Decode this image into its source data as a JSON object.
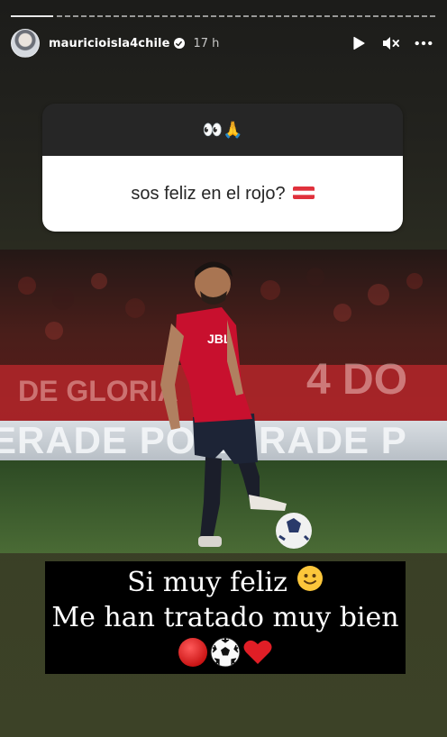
{
  "story": {
    "progress_fraction": 0.1,
    "header": {
      "username": "mauricioisla4chile",
      "verified": true,
      "time": "17 h",
      "controls": [
        "play-icon",
        "mute-icon",
        "more-icon"
      ]
    },
    "question_sticker": {
      "emojis": "👀🙏",
      "text": "sos feliz en el rojo?",
      "flag": "austria-flag-icon"
    },
    "photo": {
      "subject": "football-player-photo",
      "shirt_sponsor": "JBL",
      "board_text": "ERADE POWERADE"
    },
    "caption": {
      "line1": "Si muy feliz",
      "line1_emoji": "slightly-smiling-face-icon",
      "line2": "Me han tratado muy bien",
      "emojis": [
        "red-circle-icon",
        "soccer-ball-icon",
        "red-heart-icon"
      ]
    }
  },
  "colors": {
    "sticker_dark": "#262626",
    "sticker_light": "#ffffff",
    "jersey_red": "#c8102e",
    "caption_bg": "#000000"
  }
}
